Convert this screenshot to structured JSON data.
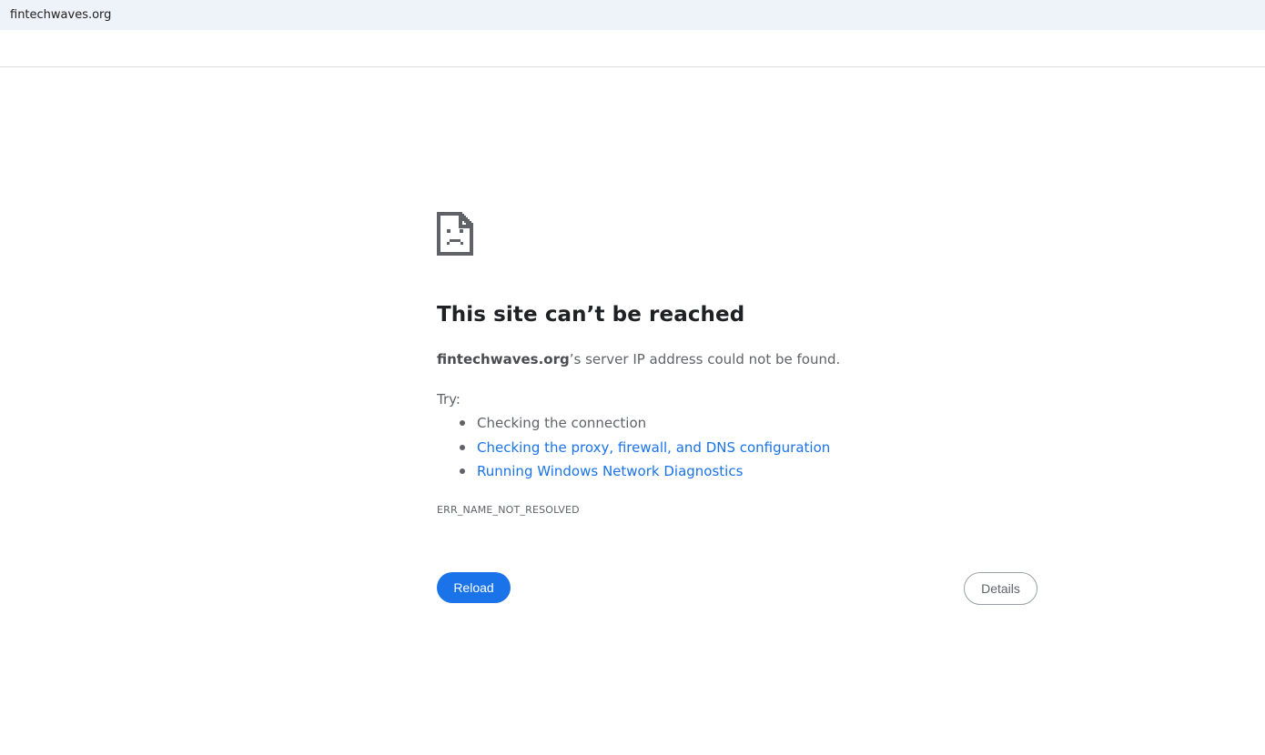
{
  "address_bar": {
    "url": "fintechwaves.org"
  },
  "error_page": {
    "icon": "sad-document-icon",
    "title": "This site can’t be reached",
    "summary_host": "fintechwaves.org",
    "summary_rest": "’s server IP address could not be found.",
    "try_label": "Try:",
    "suggestions": [
      {
        "text": "Checking the connection",
        "is_link": false
      },
      {
        "text": "Checking the proxy, firewall, and DNS configuration",
        "is_link": true
      },
      {
        "text": "Running Windows Network Diagnostics",
        "is_link": true
      }
    ],
    "error_code": "ERR_NAME_NOT_RESOLVED",
    "reload_label": "Reload",
    "details_label": "Details"
  },
  "colors": {
    "link": "#1a73e8",
    "primary_button": "#1a73e8",
    "text_secondary": "#5f6368",
    "address_bar_bg": "#eef2f9"
  }
}
